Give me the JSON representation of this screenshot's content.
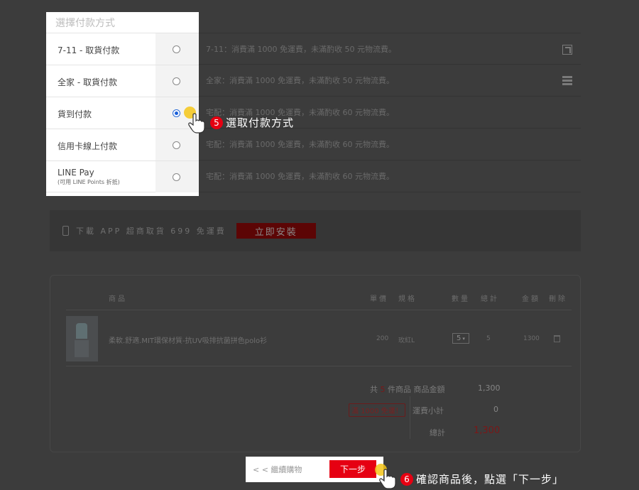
{
  "payment": {
    "title": "選擇付款方式",
    "options": [
      {
        "label": "7-11 - 取貨付款",
        "sub": "",
        "desc": "7-11：消費滿 1000 免運費，未滿酌收 50 元物流費。",
        "selected": false,
        "icon": "seven-eleven-icon"
      },
      {
        "label": "全家 - 取貨付款",
        "sub": "",
        "desc": "全家：消費滿 1000 免運費，未滿酌收 50 元物流費。",
        "selected": false,
        "icon": "familymart-icon"
      },
      {
        "label": "貨到付款",
        "sub": "",
        "desc": "宅配：消費滿 1000 免運費，未滿酌收 60 元物流費。",
        "selected": true,
        "icon": ""
      },
      {
        "label": "信用卡線上付款",
        "sub": "",
        "desc": "宅配：消費滿 1000 免運費，未滿酌收 60 元物流費。",
        "selected": false,
        "icon": ""
      },
      {
        "label": "LINE Pay",
        "sub": "(可用 LINE Points 折抵)",
        "desc": "宅配：消費滿 1000 免運費，未滿酌收 60 元物流費。",
        "selected": false,
        "icon": ""
      }
    ]
  },
  "app_banner": {
    "text": "下載 APP 超商取貨 699 免運費",
    "button": "立即安裝"
  },
  "cart": {
    "headers": {
      "product": "商品",
      "price": "單價",
      "spec": "規格",
      "qty": "數量",
      "subtotal": "總計",
      "amount": "金額",
      "delete": "刪除"
    },
    "item": {
      "name": "柔軟.舒適.MIT環保材質-抗UV吸排抗菌拼色polo衫",
      "price": "200",
      "spec": "玫紅L",
      "qty": "5",
      "subtotal": "5",
      "amount": "1300"
    },
    "summary": {
      "count_prefix": "共",
      "count": "5",
      "count_suffix": "件商品 商品金額",
      "goods_amount": "1,300",
      "free_tag": "滿 1000 免運！",
      "shipping_label": "運費小計",
      "shipping": "0",
      "total_label": "總計",
      "total": "1,300"
    }
  },
  "nav": {
    "continue": "< < 繼續購物",
    "next": "下一步"
  },
  "steps": {
    "step5_num": "5",
    "step5_text": "選取付款方式",
    "step6_num": "6",
    "step6_text": "確認商品後，點選「下一步」"
  },
  "colors": {
    "accent": "#e60012",
    "radio_selected": "#1a5fd9",
    "tap_highlight": "#f5c518"
  }
}
